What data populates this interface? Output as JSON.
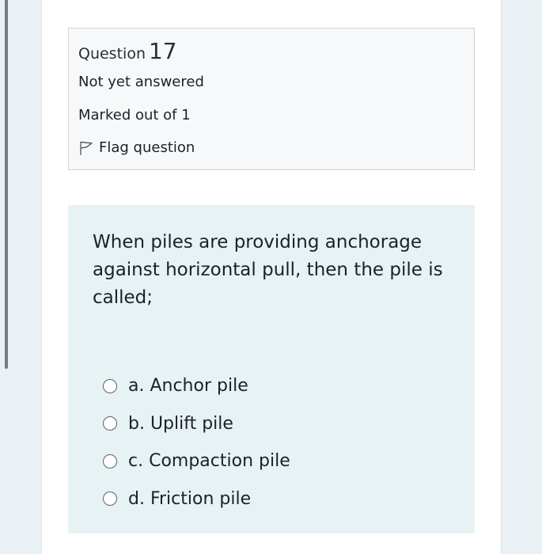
{
  "question": {
    "label": "Question",
    "number": "17",
    "state": "Not yet answered",
    "grade": "Marked out of 1",
    "flag_label": "Flag question",
    "flag_icon": "flag-outline-icon",
    "text": "When piles are providing anchorage against horizontal pull, then the pile is called;"
  },
  "answers": [
    {
      "label": "a. Anchor pile",
      "selected": false
    },
    {
      "label": "b. Uplift pile",
      "selected": false
    },
    {
      "label": "c. Compaction pile",
      "selected": false
    },
    {
      "label": "d. Friction pile",
      "selected": false
    }
  ]
}
